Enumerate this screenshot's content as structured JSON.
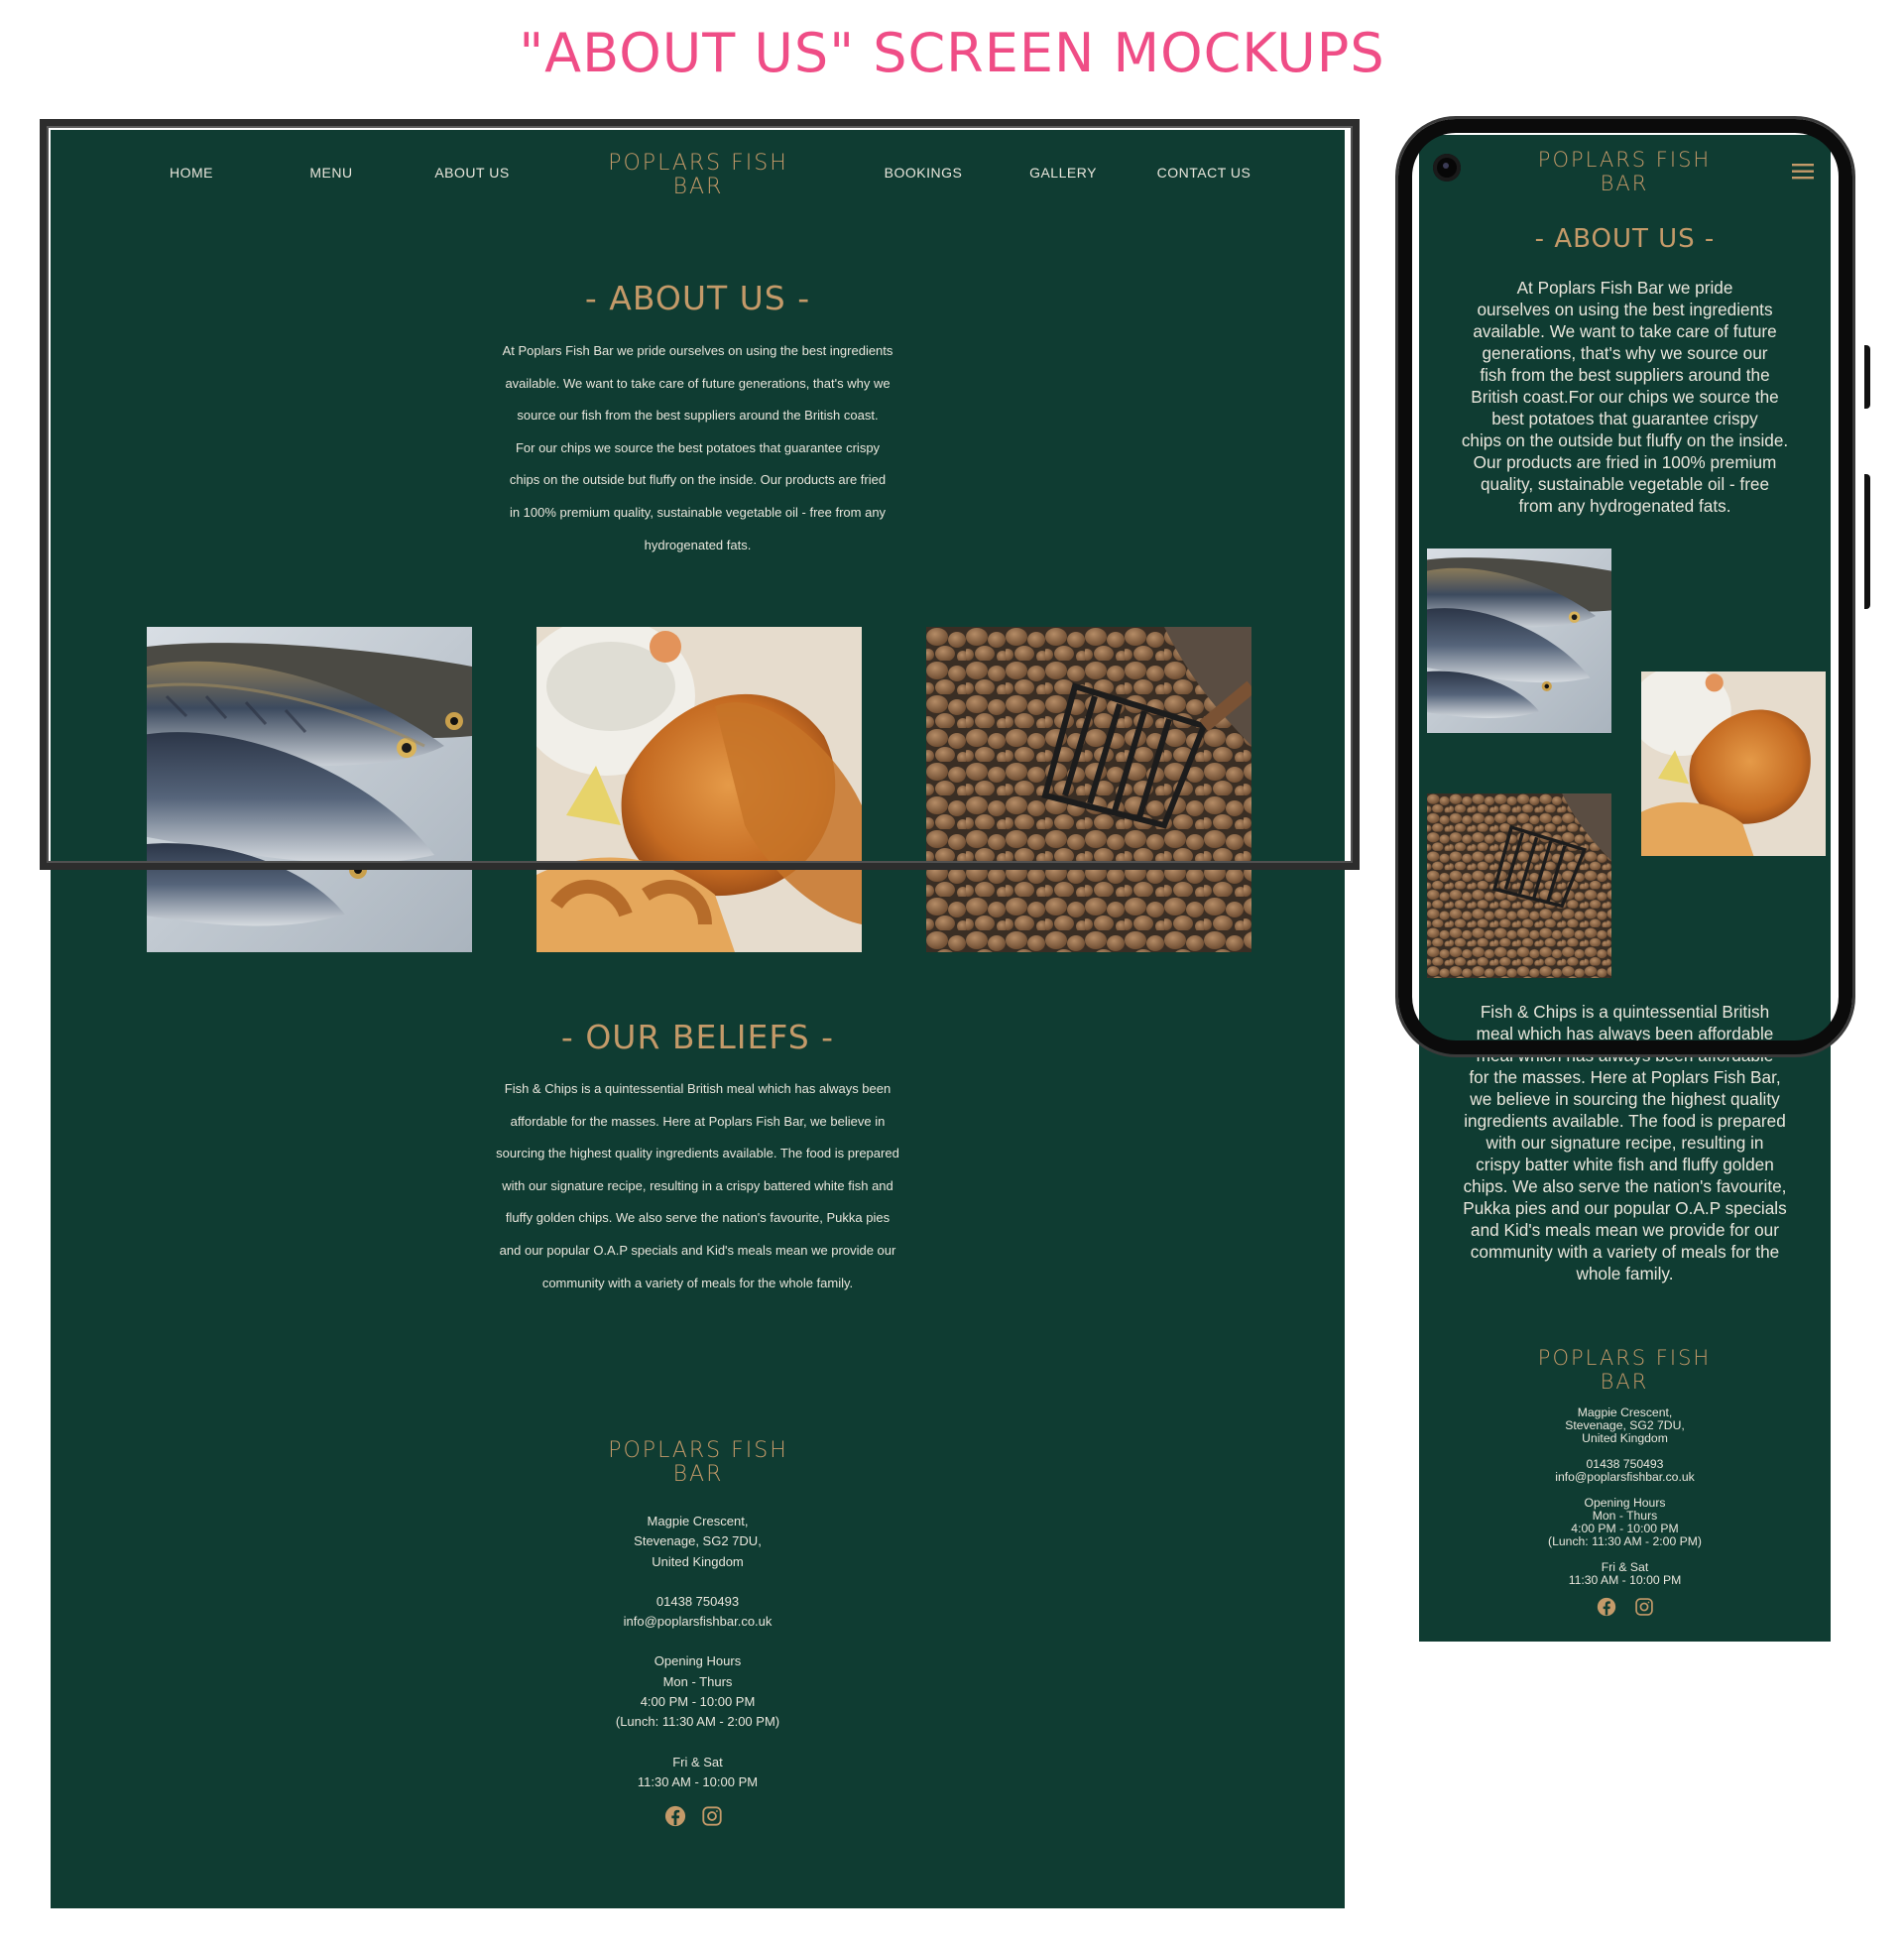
{
  "page_title": "\"ABOUT US\" SCREEN MOCKUPS",
  "colors": {
    "accent": "#ef4d86",
    "background": "#0f3c32",
    "gold": "#c49a69",
    "text": "#e9e6dc"
  },
  "desktop": {
    "nav": {
      "home": "HOME",
      "menu": "MENU",
      "about": "ABOUT US",
      "bookings": "BOOKINGS",
      "gallery": "GALLERY",
      "contact": "CONTACT US"
    },
    "brand": {
      "line1": "POPLARS FISH",
      "line2": "BAR"
    },
    "about": {
      "title": "- ABOUT US -",
      "lines": [
        "At Poplars Fish Bar we pride ourselves on using the best ingredients",
        "available. We want to take care of future generations, that's why we",
        "source our fish from the best suppliers around the British coast.",
        "For our chips we source the best potatoes that guarantee crispy",
        "chips on the outside but fluffy on the inside. Our products are fried",
        "in 100% premium quality, sustainable vegetable oil - free from any",
        "hydrogenated fats."
      ]
    },
    "photos": [
      "fish-on-ice",
      "fried-fish-and-chips",
      "potatoes"
    ],
    "beliefs": {
      "title": "- OUR BELIEFS -",
      "lines": [
        "Fish & Chips is a quintessential British meal which has always been",
        "affordable for the masses. Here at Poplars Fish Bar, we believe in",
        "sourcing the highest quality ingredients available. The food is prepared",
        "with our signature recipe, resulting in a crispy battered white fish and",
        "fluffy golden chips. We also serve the nation's favourite, Pukka pies",
        "and our popular O.A.P specials and Kid's meals mean we provide our",
        "community with a variety of meals for the whole family."
      ]
    },
    "footer": {
      "brand_line1": "POPLARS FISH",
      "brand_line2": "BAR",
      "address1": "Magpie Crescent,",
      "address2": "Stevenage, SG2 7DU,",
      "address3": "United Kingdom",
      "phone": "01438 750493",
      "email": "info@poplarsfishbar.co.uk",
      "hours_title": "Opening Hours",
      "hours_days1": "Mon - Thurs",
      "hours_time1": "4:00 PM - 10:00 PM",
      "hours_lunch": "(Lunch: 11:30 AM - 2:00 PM)",
      "hours_days2": "Fri & Sat",
      "hours_time2": "11:30 AM - 10:00 PM"
    }
  },
  "mobile": {
    "brand": {
      "line1": "POPLARS FISH",
      "line2": "BAR"
    },
    "about": {
      "title": "- ABOUT US -",
      "lines": [
        "At Poplars Fish Bar we pride",
        "ourselves on using the best ingredients",
        "available. We want to take care of future",
        "generations, that's why we source our",
        "fish from the best suppliers around the",
        "British coast.For our chips we source the",
        "best potatoes that guarantee crispy",
        "chips on the outside but fluffy on the inside.",
        "Our products are fried in 100% premium",
        "quality, sustainable vegetable oil - free",
        "from any hydrogenated fats."
      ]
    },
    "beliefs": {
      "lines": [
        "Fish & Chips is a quintessential British",
        "meal which has always been affordable",
        "meal which has always been affordable",
        "for the masses. Here at Poplars Fish Bar,",
        "we believe in sourcing the highest quality",
        "ingredients available. The food is prepared",
        "with our signature recipe, resulting in",
        "crispy batter white fish and fluffy golden",
        "chips. We also serve the nation's favourite,",
        "Pukka pies and our popular O.A.P specials",
        "and Kid's meals mean we provide for our",
        "community with a variety of meals for the",
        "whole family."
      ]
    },
    "footer": {
      "brand_line1": "POPLARS FISH",
      "brand_line2": "BAR",
      "address1": "Magpie Crescent,",
      "address2": "Stevenage, SG2 7DU,",
      "address3": "United Kingdom",
      "phone": "01438 750493",
      "email": "info@poplarsfishbar.co.uk",
      "hours_title": "Opening Hours",
      "hours_days1": "Mon - Thurs",
      "hours_time1": "4:00 PM - 10:00 PM",
      "hours_lunch": "(Lunch: 11:30 AM - 2:00 PM)",
      "hours_days2": "Fri & Sat",
      "hours_time2": "11:30 AM - 10:00 PM"
    }
  }
}
